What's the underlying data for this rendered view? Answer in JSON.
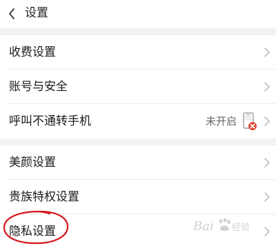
{
  "header": {
    "title": "设置"
  },
  "section1": [
    {
      "label": "收费设置"
    },
    {
      "label": "账号与安全"
    },
    {
      "label": "呼叫不通转手机",
      "status": "未开启"
    }
  ],
  "section2": [
    {
      "label": "美颜设置"
    },
    {
      "label": "贵族特权设置"
    },
    {
      "label": "隐私设置"
    }
  ],
  "icons": {
    "back": "chevron-left-icon",
    "chevron": "chevron-right-icon",
    "phone_off": "phone-off-icon"
  },
  "colors": {
    "annotation": "#d8141b",
    "status_badge": "#e24b3b"
  },
  "watermark": {
    "text": "Baidu 经验"
  }
}
